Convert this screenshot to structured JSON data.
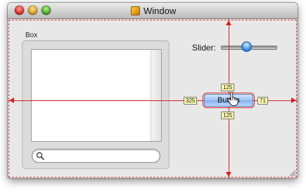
{
  "window": {
    "title": "Window"
  },
  "box": {
    "label": "Box"
  },
  "search": {
    "value": ""
  },
  "slider": {
    "label": "Slider:",
    "value_fraction": 0.55
  },
  "button": {
    "label": "Button"
  },
  "guides": {
    "top": "125",
    "bottom": "125",
    "left": "325",
    "right": "71"
  },
  "colors": {
    "guide": "#d62020",
    "button_fill": "#9fc2f2",
    "measure_fill": "#ffffb3",
    "slider_knob": "#3b8fe0"
  },
  "icons": {
    "title": "app-icon",
    "search": "magnifier",
    "cursor": "hand-pointer",
    "resize": "grow-box"
  }
}
